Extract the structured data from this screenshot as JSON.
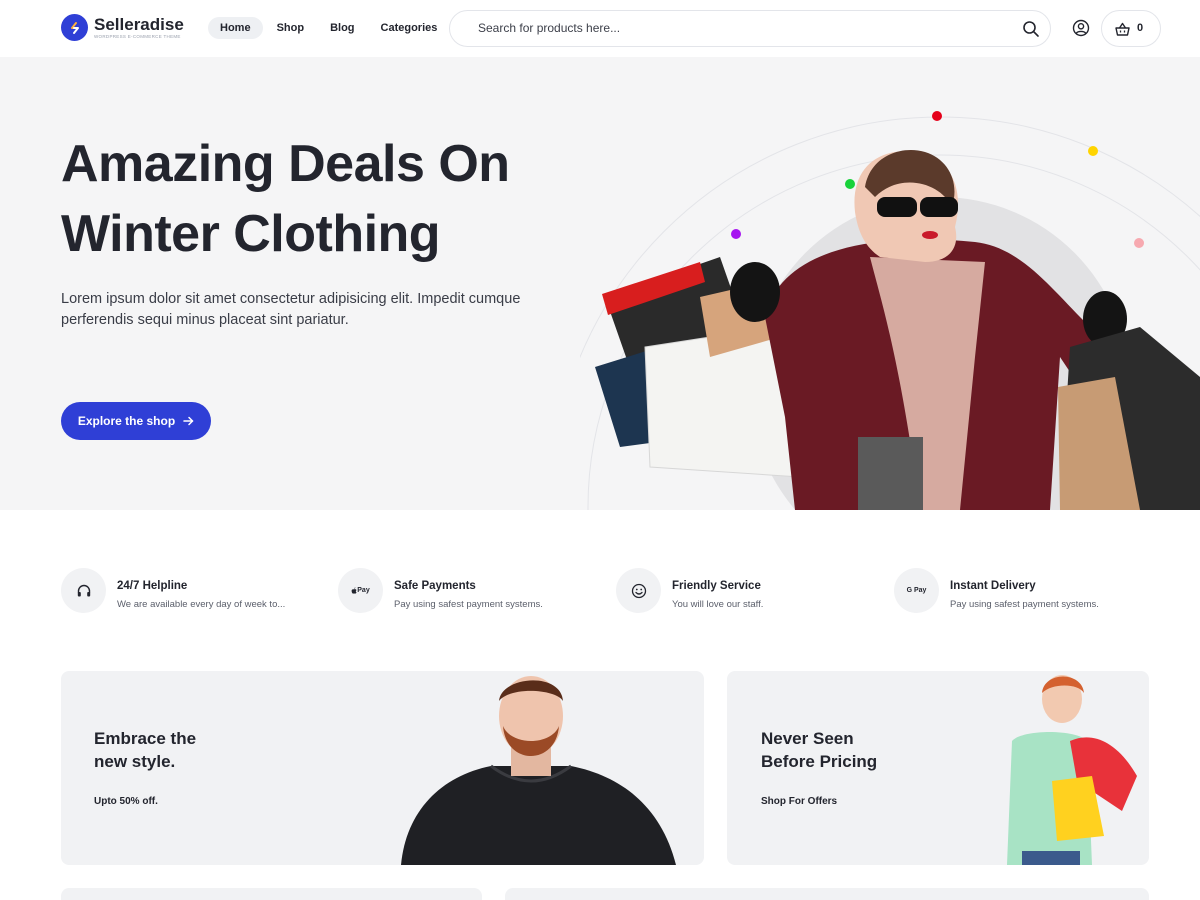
{
  "brand": {
    "name": "Selleradise",
    "tagline": "WORDPRESS E-COMMERCE THEME",
    "accent": "#2f3fd6"
  },
  "nav": {
    "items": [
      {
        "label": "Home",
        "active": true
      },
      {
        "label": "Shop",
        "active": false
      },
      {
        "label": "Blog",
        "active": false
      },
      {
        "label": "Categories",
        "active": false
      }
    ]
  },
  "search": {
    "placeholder": "Search for products here..."
  },
  "cart": {
    "count": "0"
  },
  "hero": {
    "title_line1": "Amazing Deals On",
    "title_line2": "Winter Clothing",
    "description": "Lorem ipsum dolor sit amet consectetur adipisicing elit. Impedit cumque perferendis sequi minus placeat sint pariatur.",
    "button_label": "Explore the shop",
    "dot_colors": [
      "#e5001a",
      "#ffd400",
      "#18d23a",
      "#a614f0",
      "#f7a9b0"
    ]
  },
  "features": [
    {
      "icon": "headphones-icon",
      "title": "24/7 Helpline",
      "description": "We are available every day of week to..."
    },
    {
      "icon": "apple-pay-icon",
      "icon_text": "Pay",
      "title": "Safe Payments",
      "description": "Pay using safest payment systems."
    },
    {
      "icon": "smile-icon",
      "title": "Friendly Service",
      "description": "You will love our staff."
    },
    {
      "icon": "google-pay-icon",
      "icon_text": "G Pay",
      "title": "Instant Delivery",
      "description": "Pay using safest payment systems."
    }
  ],
  "promos": [
    {
      "title_line1": "Embrace the",
      "title_line2": "new style.",
      "subtitle": "Upto 50% off."
    },
    {
      "title_line1": "Never Seen",
      "title_line2": "Before Pricing",
      "subtitle": "Shop For Offers"
    }
  ]
}
